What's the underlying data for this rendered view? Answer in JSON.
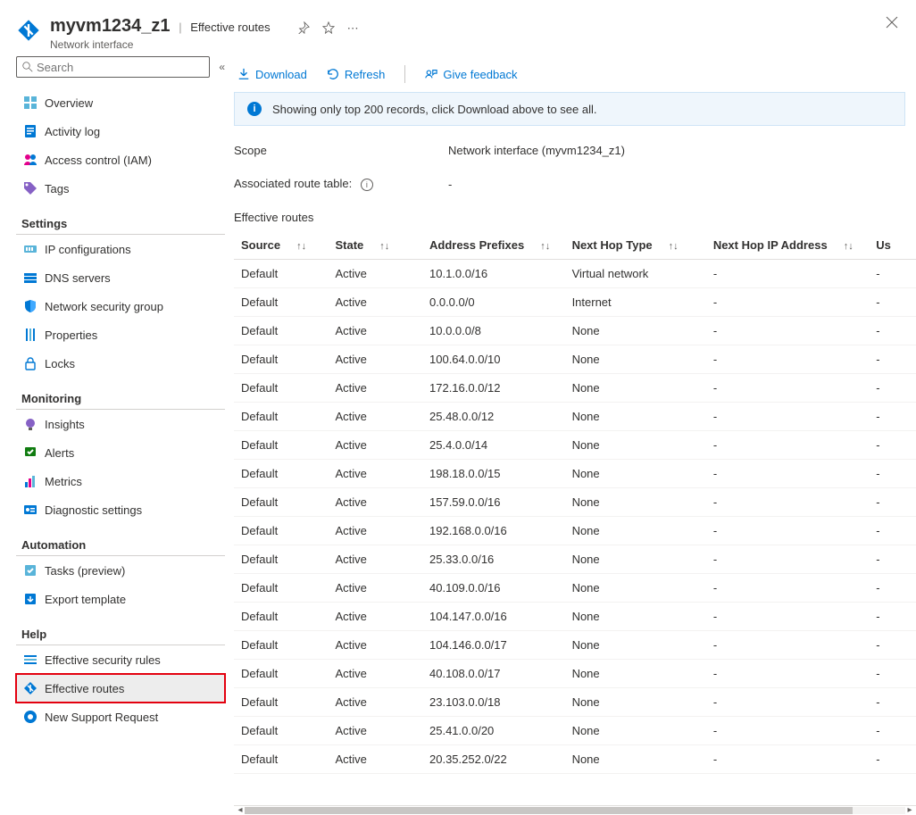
{
  "header": {
    "resource_name": "myvm1234_z1",
    "blade_name": "Effective routes",
    "resource_type": "Network interface"
  },
  "sidebar": {
    "search_placeholder": "Search",
    "top": [
      {
        "key": "overview",
        "label": "Overview",
        "icon": "grid"
      },
      {
        "key": "activity",
        "label": "Activity log",
        "icon": "log"
      },
      {
        "key": "iam",
        "label": "Access control (IAM)",
        "icon": "iam"
      },
      {
        "key": "tags",
        "label": "Tags",
        "icon": "tag"
      }
    ],
    "groups": [
      {
        "title": "Settings",
        "items": [
          {
            "key": "ipconf",
            "label": "IP configurations",
            "icon": "ipconf"
          },
          {
            "key": "dns",
            "label": "DNS servers",
            "icon": "dns"
          },
          {
            "key": "nsg",
            "label": "Network security group",
            "icon": "shield"
          },
          {
            "key": "props",
            "label": "Properties",
            "icon": "props"
          },
          {
            "key": "locks",
            "label": "Locks",
            "icon": "lock"
          }
        ]
      },
      {
        "title": "Monitoring",
        "items": [
          {
            "key": "insights",
            "label": "Insights",
            "icon": "bulb"
          },
          {
            "key": "alerts",
            "label": "Alerts",
            "icon": "alerts"
          },
          {
            "key": "metrics",
            "label": "Metrics",
            "icon": "metrics"
          },
          {
            "key": "diag",
            "label": "Diagnostic settings",
            "icon": "diag"
          }
        ]
      },
      {
        "title": "Automation",
        "items": [
          {
            "key": "tasks",
            "label": "Tasks (preview)",
            "icon": "tasks"
          },
          {
            "key": "export",
            "label": "Export template",
            "icon": "export"
          }
        ]
      },
      {
        "title": "Help",
        "items": [
          {
            "key": "secrules",
            "label": "Effective security rules",
            "icon": "secrules"
          },
          {
            "key": "routes",
            "label": "Effective routes",
            "icon": "routes"
          },
          {
            "key": "support",
            "label": "New Support Request",
            "icon": "support"
          }
        ]
      }
    ],
    "selected_key": "routes"
  },
  "toolbar": {
    "download": "Download",
    "refresh": "Refresh",
    "feedback": "Give feedback"
  },
  "banner": {
    "text": "Showing only top 200 records, click Download above to see all."
  },
  "scope": {
    "label": "Scope",
    "value": "Network interface (myvm1234_z1)"
  },
  "associated": {
    "label": "Associated route table:",
    "value": "-"
  },
  "table": {
    "title": "Effective routes",
    "columns": [
      "Source",
      "State",
      "Address Prefixes",
      "Next Hop Type",
      "Next Hop IP Address",
      "Us"
    ],
    "rows": [
      {
        "source": "Default",
        "state": "Active",
        "prefix": "10.1.0.0/16",
        "nht": "Virtual network",
        "nhip": "-",
        "us": "-"
      },
      {
        "source": "Default",
        "state": "Active",
        "prefix": "0.0.0.0/0",
        "nht": "Internet",
        "nhip": "-",
        "us": "-"
      },
      {
        "source": "Default",
        "state": "Active",
        "prefix": "10.0.0.0/8",
        "nht": "None",
        "nhip": "-",
        "us": "-"
      },
      {
        "source": "Default",
        "state": "Active",
        "prefix": "100.64.0.0/10",
        "nht": "None",
        "nhip": "-",
        "us": "-"
      },
      {
        "source": "Default",
        "state": "Active",
        "prefix": "172.16.0.0/12",
        "nht": "None",
        "nhip": "-",
        "us": "-"
      },
      {
        "source": "Default",
        "state": "Active",
        "prefix": "25.48.0.0/12",
        "nht": "None",
        "nhip": "-",
        "us": "-"
      },
      {
        "source": "Default",
        "state": "Active",
        "prefix": "25.4.0.0/14",
        "nht": "None",
        "nhip": "-",
        "us": "-"
      },
      {
        "source": "Default",
        "state": "Active",
        "prefix": "198.18.0.0/15",
        "nht": "None",
        "nhip": "-",
        "us": "-"
      },
      {
        "source": "Default",
        "state": "Active",
        "prefix": "157.59.0.0/16",
        "nht": "None",
        "nhip": "-",
        "us": "-"
      },
      {
        "source": "Default",
        "state": "Active",
        "prefix": "192.168.0.0/16",
        "nht": "None",
        "nhip": "-",
        "us": "-"
      },
      {
        "source": "Default",
        "state": "Active",
        "prefix": "25.33.0.0/16",
        "nht": "None",
        "nhip": "-",
        "us": "-"
      },
      {
        "source": "Default",
        "state": "Active",
        "prefix": "40.109.0.0/16",
        "nht": "None",
        "nhip": "-",
        "us": "-"
      },
      {
        "source": "Default",
        "state": "Active",
        "prefix": "104.147.0.0/16",
        "nht": "None",
        "nhip": "-",
        "us": "-"
      },
      {
        "source": "Default",
        "state": "Active",
        "prefix": "104.146.0.0/17",
        "nht": "None",
        "nhip": "-",
        "us": "-"
      },
      {
        "source": "Default",
        "state": "Active",
        "prefix": "40.108.0.0/17",
        "nht": "None",
        "nhip": "-",
        "us": "-"
      },
      {
        "source": "Default",
        "state": "Active",
        "prefix": "23.103.0.0/18",
        "nht": "None",
        "nhip": "-",
        "us": "-"
      },
      {
        "source": "Default",
        "state": "Active",
        "prefix": "25.41.0.0/20",
        "nht": "None",
        "nhip": "-",
        "us": "-"
      },
      {
        "source": "Default",
        "state": "Active",
        "prefix": "20.35.252.0/22",
        "nht": "None",
        "nhip": "-",
        "us": "-"
      }
    ]
  }
}
